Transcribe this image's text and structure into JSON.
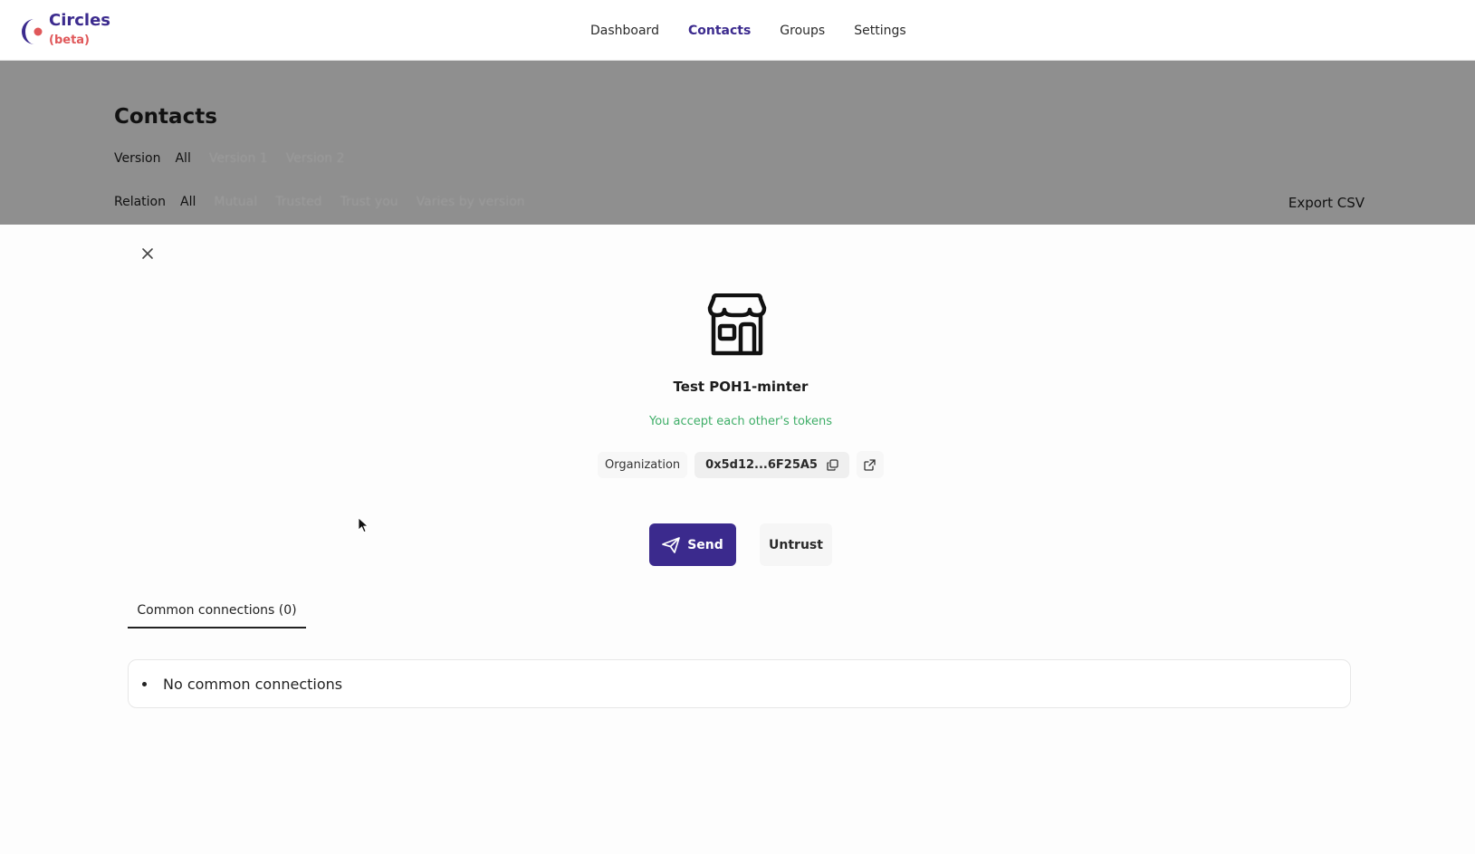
{
  "app": {
    "name": "Circles",
    "badge": "(beta)",
    "brand_color": "#3c2b8e",
    "badge_color": "#e0585a"
  },
  "nav": {
    "items": [
      {
        "label": "Dashboard",
        "active": false
      },
      {
        "label": "Contacts",
        "active": true
      },
      {
        "label": "Groups",
        "active": false
      },
      {
        "label": "Settings",
        "active": false
      }
    ]
  },
  "page": {
    "title": "Contacts",
    "version_filter": {
      "label": "Version",
      "options": [
        "All",
        "Version 1",
        "Version 2"
      ],
      "selected": "All"
    },
    "relation_filter": {
      "label": "Relation",
      "options": [
        "All",
        "Mutual",
        "Trusted",
        "Trust you",
        "Varies by version"
      ],
      "selected": "All"
    },
    "export_label": "Export CSV"
  },
  "profile": {
    "icon": "storefront-icon",
    "name": "Test POH1-minter",
    "relation_status": "You accept each other's tokens",
    "status_color": "#3fae68",
    "type": "Organization",
    "address": "0x5d12...6F25A5",
    "copy_icon": "copy-icon",
    "external_icon": "external-link-icon"
  },
  "actions": {
    "send_label": "Send",
    "untrust_label": "Untrust",
    "primary_color": "#3b2a8d"
  },
  "connections": {
    "tab_label": "Common connections (0)",
    "empty_text": "No common connections"
  }
}
